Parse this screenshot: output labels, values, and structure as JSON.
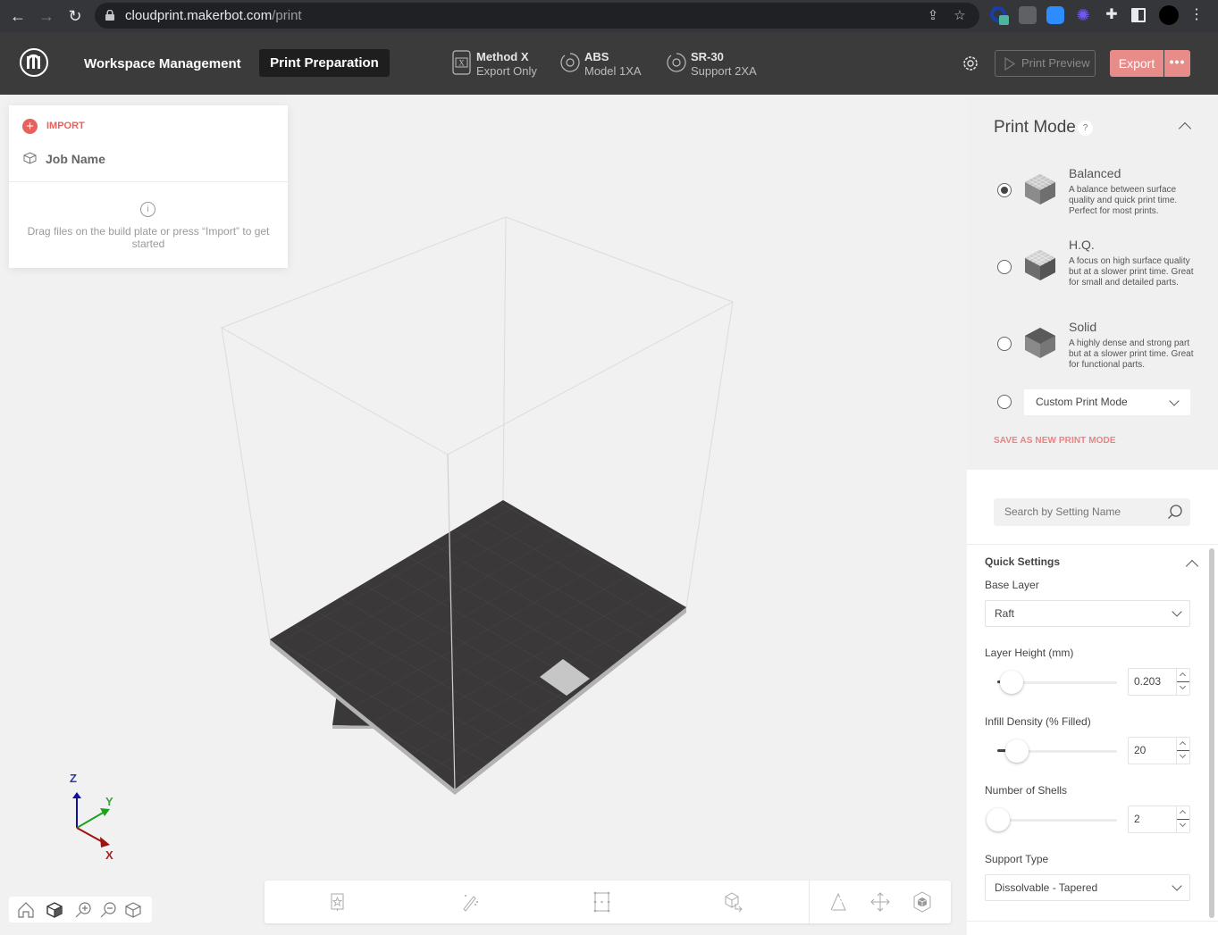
{
  "browser": {
    "url_domain": "cloudprint.makerbot.com",
    "url_path": "/print",
    "extensions": [
      "extension-badge-icon",
      "extension-overlay-icon",
      "zoom-extension-icon",
      "sun-extension-icon",
      "extensions-puzzle-icon",
      "side-panel-icon",
      "profile-avatar",
      "menu-kebab-icon"
    ]
  },
  "header": {
    "nav": {
      "workspace": "Workspace Management",
      "print_prep": "Print Preparation"
    },
    "machine": {
      "title": "Method X",
      "subtitle": "Export Only"
    },
    "model_material": {
      "title": "ABS",
      "subtitle": "Model 1XA"
    },
    "support_material": {
      "title": "SR-30",
      "subtitle": "Support 2XA"
    },
    "print_preview": "Print Preview",
    "export": "Export",
    "more": "•••",
    "colors": {
      "bar": "#3b3b3b",
      "accent": "#e88c89"
    }
  },
  "job_panel": {
    "import_label": "IMPORT",
    "job_name": "Job Name",
    "empty_hint": "Drag files on the build plate or press “Import” to get started"
  },
  "axes": {
    "z": "Z",
    "y": "Y",
    "x": "X"
  },
  "view_controls": [
    "home-view-icon",
    "iso-view-icon",
    "zoom-in-icon",
    "zoom-out-icon",
    "wireframe-cube-icon"
  ],
  "toolbar": [
    "arrange-icon",
    "magic-wand-icon",
    "scale-icon",
    "orient-icon",
    "triangle-icon",
    "move-icon",
    "cube-hex-icon"
  ],
  "print_mode": {
    "title": "Print Mode",
    "help": "?",
    "modes": [
      {
        "name": "Balanced",
        "desc": "A balance between surface quality and quick print time. Perfect for most prints.",
        "selected": true
      },
      {
        "name": "H.Q.",
        "desc": "A focus on high surface quality but at a slower print time. Great for small and detailed parts.",
        "selected": false
      },
      {
        "name": "Solid",
        "desc": "A highly dense and strong part but at a slower print time. Great for functional parts.",
        "selected": false
      }
    ],
    "custom_select": "Custom Print Mode",
    "save_as_new": "SAVE AS NEW PRINT MODE"
  },
  "settings": {
    "search_placeholder": "Search by Setting Name",
    "quick_settings_title": "Quick Settings",
    "base_layer": {
      "label": "Base Layer",
      "value": "Raft"
    },
    "layer_height": {
      "label": "Layer Height (mm)",
      "value": "0.203",
      "slider_fraction": 0.04
    },
    "infill": {
      "label": "Infill Density (% Filled)",
      "value": "20",
      "slider_fraction": 0.08
    },
    "shells": {
      "label": "Number of Shells",
      "value": "2",
      "slider_fraction": 0.0
    },
    "support_type": {
      "label": "Support Type",
      "value": "Dissolvable - Tapered"
    }
  }
}
